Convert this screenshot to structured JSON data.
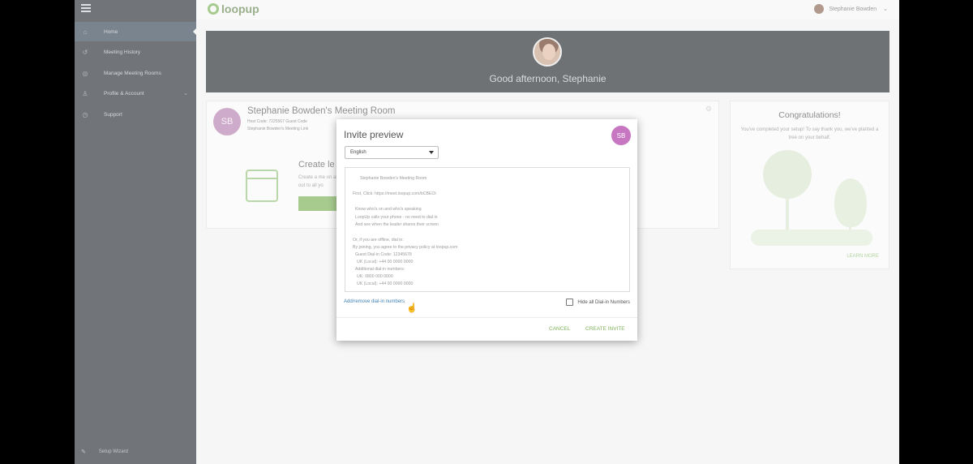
{
  "topbar": {
    "logo_text": "loopup",
    "user_name": "Stephanie Bowden"
  },
  "sidebar": {
    "items": [
      {
        "label": "Home",
        "icon": "home-icon"
      },
      {
        "label": "Meeting History",
        "icon": "history-icon"
      },
      {
        "label": "Manage Meeting Rooms",
        "icon": "rooms-icon"
      },
      {
        "label": "Profile & Account",
        "icon": "person-icon"
      },
      {
        "label": "Support",
        "icon": "support-icon"
      }
    ],
    "bottom_label": "Setup Wizard"
  },
  "banner": {
    "greeting": "Good afternoon, Stephanie"
  },
  "meeting_card": {
    "avatar_initials": "SB",
    "title": "Stephanie Bowden's Meeting Room",
    "line1": "Host Code: 7225567  Guest Code",
    "line2": "Stephanie Bowden's Meeting Link",
    "create_heading": "Create le",
    "desc": "Create a me                                                                                                                    on and join",
    "desc2": "out to all yo"
  },
  "congrats": {
    "title": "Congratulations!",
    "desc": "You've completed your setup! To say thank you, we've planted a tree on your behalf.",
    "link": "LEARN MORE"
  },
  "modal": {
    "title": "Invite preview",
    "avatar_initials": "SB",
    "language": "English",
    "preview_lines": [
      "Stephanie Bowden's Meeting Room",
      "First, Click: https://meet.loopup.com/bCBEOi",
      "Know who's on and who's speaking",
      "LoopUp calls your phone - no need to dial in",
      "And see when the leader shares their screen",
      "Or, if you are offline, dial in:",
      "By joining, you agree to the privacy policy at loopup.com",
      "Guest Dial-in Code: 12345678",
      "UK (Local):  +44 00 0000 0000",
      "Additional dial-in numbers:",
      "UK: 0800 000 0000",
      "UK (Local):  +44 00 0000 0000"
    ],
    "add_remove_link": "Add/remove dial-in numbers",
    "hide_label": "Hide all Dial-in Numbers",
    "cancel_label": "CANCEL",
    "create_label": "CREATE INVITE"
  },
  "colors": {
    "accent": "#7eb35a",
    "sidebar": "#2f3338",
    "avatar": "#c776c2",
    "link": "#3e80b5"
  }
}
